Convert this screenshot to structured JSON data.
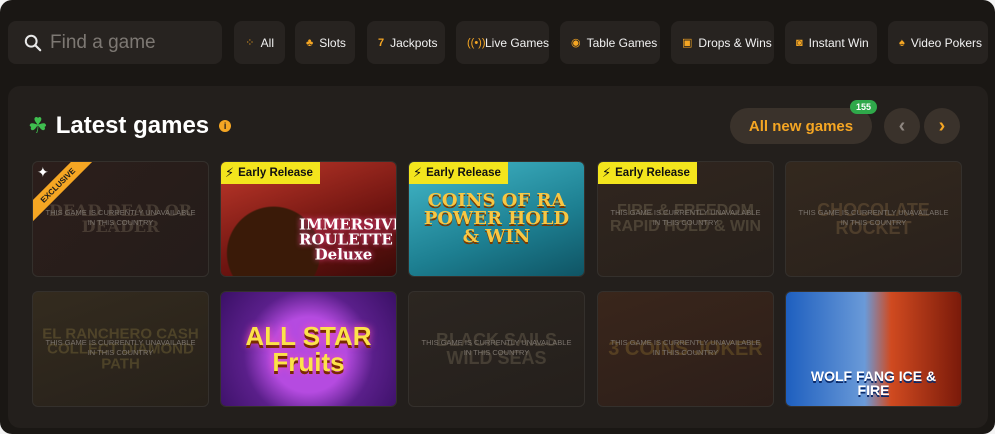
{
  "search": {
    "placeholder": "Find a game"
  },
  "categories": [
    {
      "label": "All",
      "icon": "grid-icon"
    },
    {
      "label": "Slots",
      "icon": "cherries-icon"
    },
    {
      "label": "Jackpots",
      "icon": "seven-icon"
    },
    {
      "label": "Live Games",
      "icon": "broadcast-icon"
    },
    {
      "label": "Table Games",
      "icon": "chip-icon"
    },
    {
      "label": "Drops & Wins",
      "icon": "gift-icon"
    },
    {
      "label": "Instant Win",
      "icon": "gamepad-icon"
    },
    {
      "label": "Video Pokers",
      "icon": "spade-icon"
    }
  ],
  "section": {
    "title": "Latest games",
    "all_new_label": "All new games",
    "new_count": "155"
  },
  "colors": {
    "accent": "#f5a623",
    "badge_green": "#2fa84a",
    "early_yellow": "#f3e51d",
    "panel": "#231f1c"
  },
  "tiles": [
    {
      "art_title": "DEAD DEAD OR DEADER",
      "unavailable": true,
      "unavailable_text": "THIS GAME IS CURRENTLY UNAVAILABLE IN THIS COUNTRY",
      "exclusive": true,
      "exclusive_label": "EXCLUSIVE"
    },
    {
      "art_title": "IMMERSIVE ROULETTE Deluxe",
      "unavailable": false,
      "early_release": true,
      "early_label": "Early Release"
    },
    {
      "art_title": "COINS OF RA POWER HOLD & WIN",
      "unavailable": false,
      "early_release": true,
      "early_label": "Early Release"
    },
    {
      "art_title": "FIRE & FREEDOM RAPID HOLD & WIN",
      "unavailable": true,
      "unavailable_text": "THIS GAME IS CURRENTLY UNAVAILABLE IN THIS COUNTRY",
      "early_release": true,
      "early_label": "Early Release"
    },
    {
      "art_title": "CHOCOLATE ROCKET",
      "unavailable": true,
      "unavailable_text": "THIS GAME IS CURRENTLY UNAVAILABLE IN THIS COUNTRY"
    },
    {
      "art_title": "EL RANCHERO CASH COLLECT DIAMOND PATH",
      "unavailable": true,
      "unavailable_text": "THIS GAME IS CURRENTLY UNAVAILABLE IN THIS COUNTRY"
    },
    {
      "art_title": "ALL STAR Fruits",
      "unavailable": false
    },
    {
      "art_title": "BLACK SAILS WILD SEAS",
      "unavailable": true,
      "unavailable_text": "THIS GAME IS CURRENTLY UNAVAILABLE IN THIS COUNTRY"
    },
    {
      "art_title": "3 COINS JOKER",
      "unavailable": true,
      "unavailable_text": "THIS GAME IS CURRENTLY UNAVAILABLE IN THIS COUNTRY"
    },
    {
      "art_title": "WOLF FANG ICE & FIRE",
      "unavailable": false
    }
  ]
}
